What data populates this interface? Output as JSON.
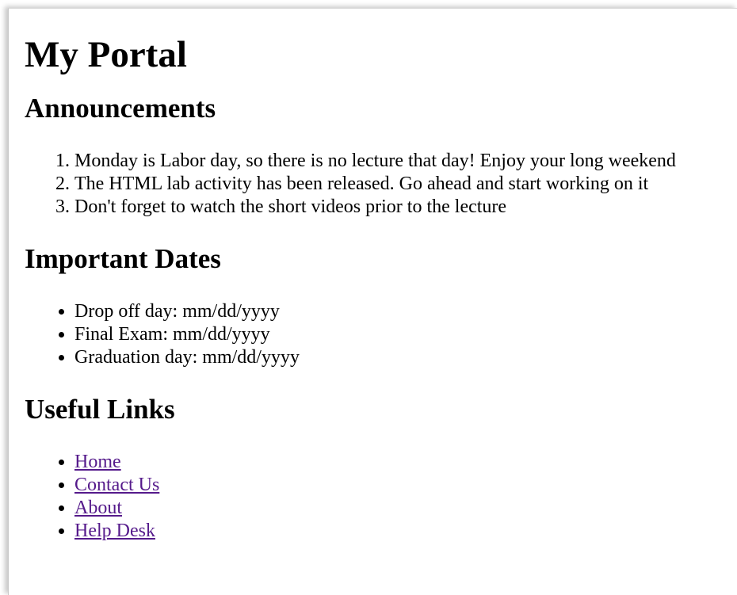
{
  "page": {
    "title": "My Portal"
  },
  "announcements": {
    "heading": "Announcements",
    "items": [
      "Monday is Labor day, so there is no lecture that day! Enjoy your long weekend",
      "The HTML lab activity has been released. Go ahead and start working on it",
      "Don't forget to watch the short videos prior to the lecture"
    ]
  },
  "important_dates": {
    "heading": "Important Dates",
    "items": [
      "Drop off day: mm/dd/yyyy",
      "Final Exam: mm/dd/yyyy",
      "Graduation day: mm/dd/yyyy"
    ]
  },
  "useful_links": {
    "heading": "Useful Links",
    "items": [
      "Home",
      "Contact Us",
      "About",
      "Help Desk"
    ]
  },
  "colors": {
    "link_visited": "#551a8b",
    "text": "#000000",
    "background": "#ffffff"
  }
}
